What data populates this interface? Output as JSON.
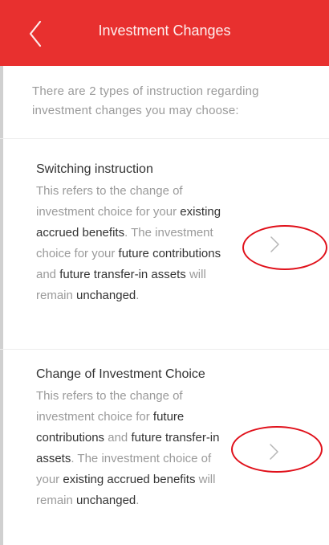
{
  "header": {
    "title": "Investment Changes",
    "back_icon": "chevron-left-icon",
    "background_color": "#e8302f"
  },
  "intro_text": "There are 2 types of instruction regarding investment changes you may choose:",
  "options": [
    {
      "title": "Switching instruction",
      "desc": {
        "p1": "This refers to the change of investment choice for your ",
        "b1": "existing accrued benefits",
        "p2": ". The investment choice for your ",
        "b2": "future contributions",
        "p3": " and ",
        "b3": "future transfer-in assets",
        "p4": " will remain ",
        "b4": "unchanged",
        "p5": "."
      },
      "chevron_icon": "chevron-right-icon"
    },
    {
      "title": "Change of Investment Choice",
      "desc": {
        "p1": "This refers to the change of investment choice for ",
        "b1": "future contributions",
        "p2": " and ",
        "b2": "future transfer-in assets",
        "p3": ". The investment choice of your ",
        "b3": "existing accrued benefits",
        "p4": " will remain ",
        "b4": "unchanged",
        "p5": "."
      },
      "chevron_icon": "chevron-right-icon"
    }
  ],
  "colors": {
    "accent": "#e8302f",
    "annotation_circle": "#e0101a",
    "muted_text": "#9a9a9a",
    "dark_text": "#333333"
  }
}
